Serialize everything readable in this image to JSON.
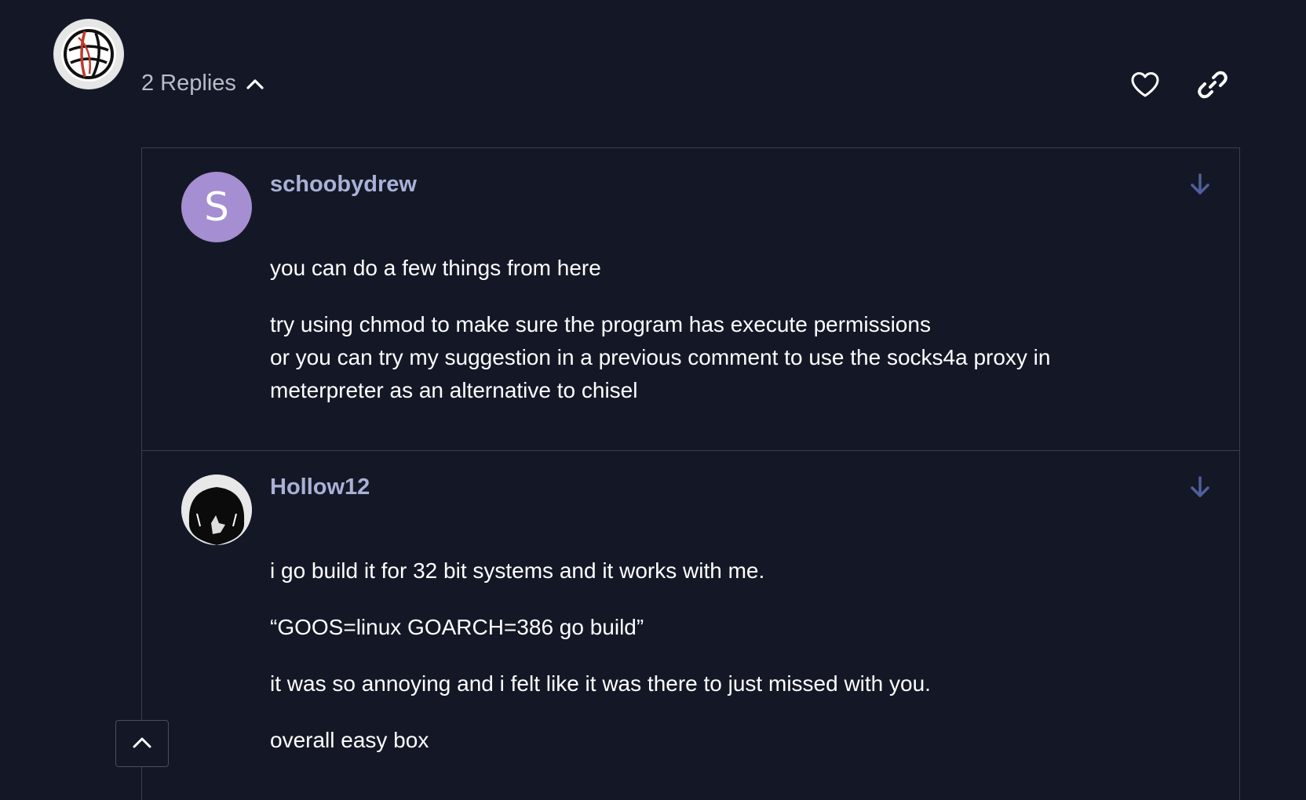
{
  "post": {
    "avatar_icon": "basketball-logo-icon",
    "replies_label": "2 Replies",
    "like_icon": "heart-icon",
    "link_icon": "link-icon"
  },
  "replies": [
    {
      "username": "schoobydrew",
      "avatar_letter": "S",
      "avatar_color": "#a58ed1",
      "paragraphs": [
        "you can do a few things from here",
        "try using chmod to make sure the program has execute permissions",
        "or you can try my suggestion in a previous comment to use the socks4a proxy in meterpreter as an alternative to chisel"
      ]
    },
    {
      "username": "Hollow12",
      "paragraphs": [
        "i go build it for 32 bit systems and it works with me.",
        "“GOOS=linux GOARCH=386 go build”",
        "it was so annoying and i felt like it was there to just missed with you.",
        "overall easy box"
      ]
    }
  ],
  "colors": {
    "background": "#141826",
    "username": "#a9b1d6",
    "arrow": "#4f5f9a",
    "border": "#3b3f4b"
  }
}
